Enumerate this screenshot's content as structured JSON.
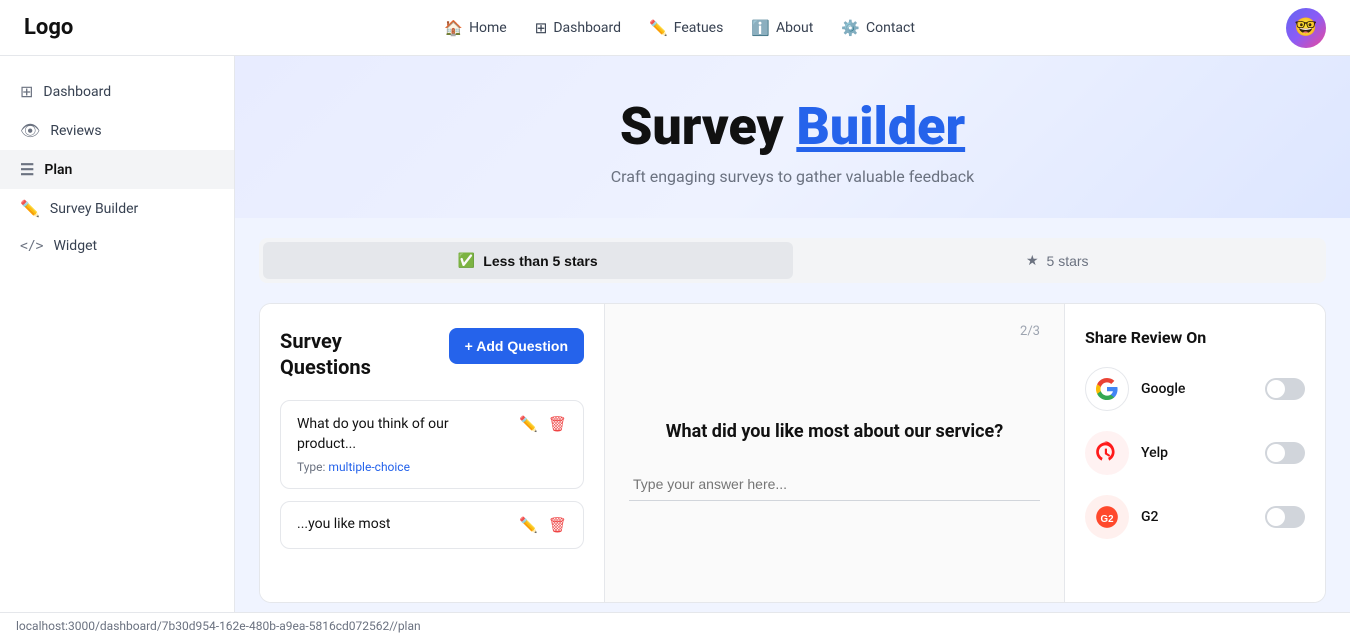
{
  "nav": {
    "logo": "Logo",
    "links": [
      {
        "id": "home",
        "icon": "🏠",
        "label": "Home"
      },
      {
        "id": "dashboard",
        "icon": "⊞",
        "label": "Dashboard"
      },
      {
        "id": "features",
        "icon": "✏️",
        "label": "Featues"
      },
      {
        "id": "about",
        "icon": "ℹ️",
        "label": "About"
      },
      {
        "id": "contact",
        "icon": "⚙️",
        "label": "Contact"
      }
    ]
  },
  "sidebar": {
    "items": [
      {
        "id": "dashboard",
        "icon": "⊞",
        "label": "Dashboard",
        "active": false
      },
      {
        "id": "reviews",
        "icon": "👁",
        "label": "Reviews",
        "active": false
      },
      {
        "id": "plan",
        "icon": "☰",
        "label": "Plan",
        "active": true
      },
      {
        "id": "survey-builder",
        "icon": "✏️",
        "label": "Survey Builder",
        "active": false
      },
      {
        "id": "widget",
        "icon": "</>",
        "label": "Widget",
        "active": false
      }
    ]
  },
  "hero": {
    "title_plain": "Survey",
    "title_blue": "Builder",
    "subtitle": "Craft engaging surveys to gather valuable feedback"
  },
  "tabs": [
    {
      "id": "less-than-5",
      "icon": "✓",
      "label": "Less than 5 stars",
      "active": true
    },
    {
      "id": "5-stars",
      "icon": "★",
      "label": "5 stars",
      "active": false
    }
  ],
  "builder": {
    "questions_title": "Survey\nQuestions",
    "add_button": "+ Add Question",
    "counter": "2/3",
    "questions": [
      {
        "text": "What do you think of our product...",
        "type_label": "Type:",
        "type_value": "multiple-choice"
      },
      {
        "text": "...you like most"
      }
    ],
    "preview": {
      "question": "What did you like most about our service?",
      "placeholder": "Type your answer here..."
    },
    "share": {
      "title": "Share Review On",
      "platforms": [
        {
          "id": "google",
          "name": "Google",
          "color": "#fff",
          "border": true,
          "emoji": "G",
          "on": false
        },
        {
          "id": "yelp",
          "name": "Yelp",
          "color": "#fff2f2",
          "emoji": "✶",
          "on": false
        },
        {
          "id": "g2",
          "name": "G2",
          "color": "#fff0ee",
          "emoji": "●",
          "on": false
        }
      ]
    }
  },
  "status_bar": {
    "url": "localhost:3000/dashboard/7b30d954-162e-480b-a9ea-5816cd072562//plan"
  }
}
